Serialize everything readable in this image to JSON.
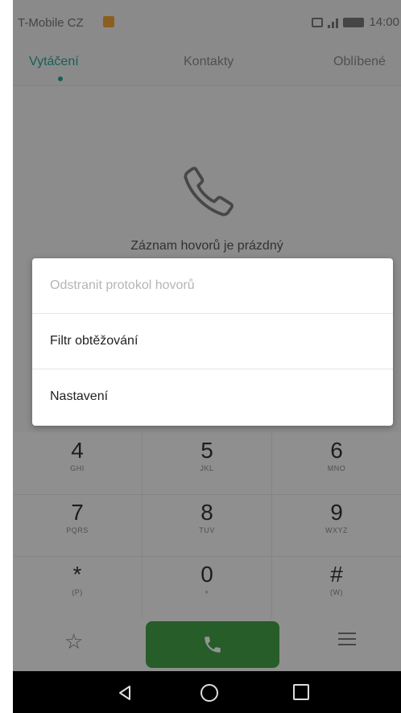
{
  "status_bar": {
    "carrier": "T-Mobile CZ",
    "time": "14:00"
  },
  "tabs": [
    {
      "label": "Vytáčení",
      "active": true
    },
    {
      "label": "Kontakty",
      "active": false
    },
    {
      "label": "Oblíbené",
      "active": false
    }
  ],
  "call_log": {
    "empty_message": "Záznam hovorů je prázdný"
  },
  "overflow_menu": {
    "items": [
      {
        "label": "Odstranit protokol hovorů",
        "enabled": false
      },
      {
        "label": "Filtr obtěžování",
        "enabled": true
      },
      {
        "label": "Nastavení",
        "enabled": true
      }
    ]
  },
  "keypad": {
    "keys": [
      {
        "digit": "4",
        "letters": "GHI"
      },
      {
        "digit": "5",
        "letters": "JKL"
      },
      {
        "digit": "6",
        "letters": "MNO"
      },
      {
        "digit": "7",
        "letters": "PQRS"
      },
      {
        "digit": "8",
        "letters": "TUV"
      },
      {
        "digit": "9",
        "letters": "WXYZ"
      },
      {
        "digit": "*",
        "letters": "(P)"
      },
      {
        "digit": "0",
        "letters": "+"
      },
      {
        "digit": "#",
        "letters": "(W)"
      }
    ]
  },
  "bottom_actions": {
    "favorites_icon": "star-outline-icon",
    "call_icon": "phone-icon",
    "menu_icon": "hamburger-menu-icon"
  },
  "colors": {
    "accent": "#26a69a",
    "call_button": "#43a047",
    "notification": "#f1a33a"
  }
}
